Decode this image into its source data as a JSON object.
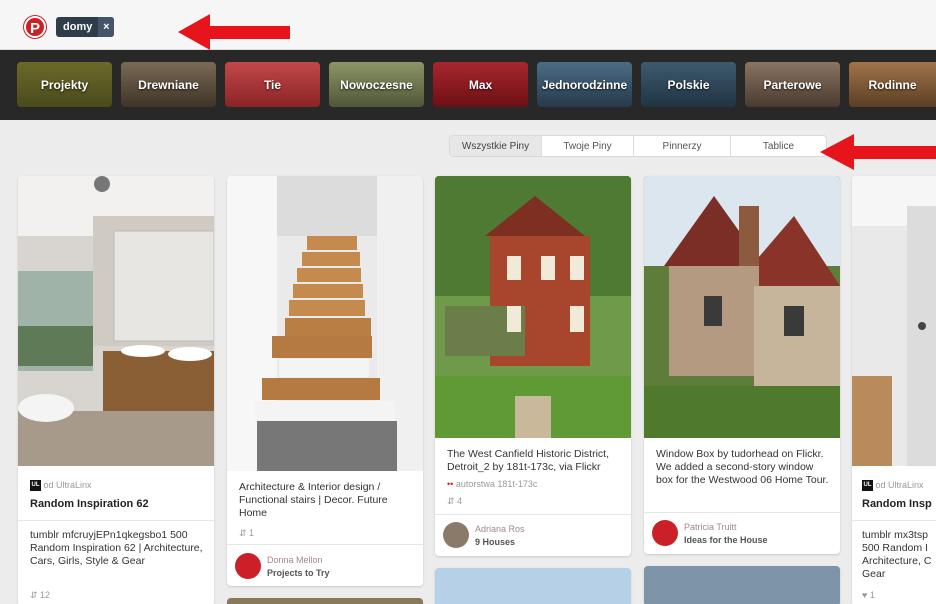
{
  "topbar": {
    "logo": "P",
    "search_tag": "domy",
    "search_tag_remove": "×"
  },
  "categories": [
    "Projekty",
    "Drewniane",
    "Tie",
    "Nowoczesne",
    "Max",
    "Jednorodzinne",
    "Polskie",
    "Parterowe",
    "Rodinne"
  ],
  "tabs": [
    "Wszystkie Piny",
    "Twoje Piny",
    "Pinnerzy",
    "Tablice"
  ],
  "pins": [
    {
      "source_prefix": "od UltraLinx",
      "title": "Random Inspiration 62",
      "description": "tumblr mfcruyjEPn1qkegsbo1 500 Random Inspiration 62 | Architecture, Cars, Girls, Style & Gear",
      "stats": "⇵ 12"
    },
    {
      "description": "Architecture & Interior design / Functional stairs | Decor. Future Home",
      "stats": "⇵ 1",
      "user": "Donna Mellon",
      "board": "Projects to Try"
    },
    {
      "description": "The West Canfield Historic District, Detroit_2 by 181t-173c, via Flickr",
      "via": "autorstwa 181t-173c",
      "stats": "⇵ 4",
      "user": "Adriana Ros",
      "board": "9 Houses"
    },
    {
      "description": "Window Box by tudorhead on Flickr. We added a second-story window box for the Westwood 06 Home Tour.",
      "user": "Patricia Truitt",
      "board": "Ideas for the House"
    },
    {
      "source_prefix": "od UltraLinx",
      "title": "Random Insp",
      "description": "tumblr mx3tsp 500 Random I Architecture, C Gear",
      "stats": "♥ 1"
    }
  ],
  "colors": {
    "pinterest_red": "#cb2027",
    "arrow_red": "#e8141c",
    "strip": "#282828"
  }
}
